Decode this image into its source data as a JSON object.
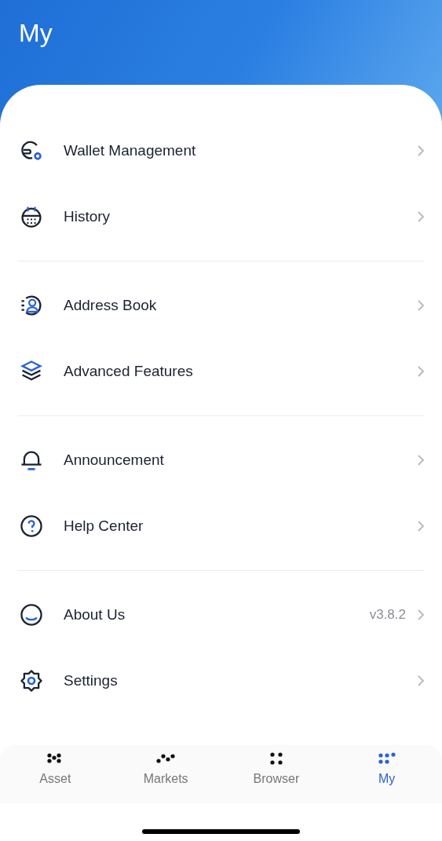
{
  "header": {
    "title": "My"
  },
  "menu_groups": [
    {
      "items": [
        {
          "label": "Wallet Management"
        },
        {
          "label": "History"
        }
      ]
    },
    {
      "items": [
        {
          "label": "Address Book"
        },
        {
          "label": "Advanced Features"
        }
      ]
    },
    {
      "items": [
        {
          "label": "Announcement"
        },
        {
          "label": "Help Center"
        }
      ]
    },
    {
      "items": [
        {
          "label": "About Us",
          "value": "v3.8.2"
        },
        {
          "label": "Settings"
        }
      ]
    }
  ],
  "tabs": [
    {
      "label": "Asset",
      "selected": false
    },
    {
      "label": "Markets",
      "selected": false
    },
    {
      "label": "Browser",
      "selected": false
    },
    {
      "label": "My",
      "selected": true
    }
  ]
}
